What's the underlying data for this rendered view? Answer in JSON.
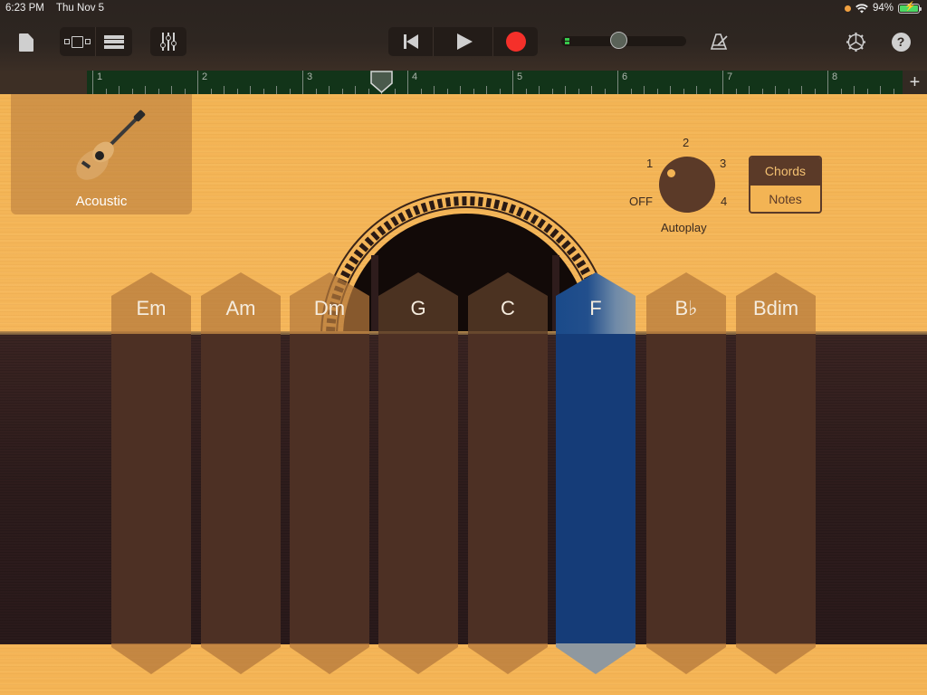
{
  "status_bar": {
    "time": "6:23 PM",
    "date": "Thu Nov 5",
    "battery_percent": "94%",
    "battery_level": 0.94,
    "charging": true
  },
  "toolbar": {
    "left_icons": [
      "document-icon",
      "tracks-view-icon",
      "list-view-icon",
      "mixer-icon"
    ],
    "transport": [
      "go-to-beginning-icon",
      "play-icon",
      "record-icon"
    ],
    "volume_level": 0.4,
    "right_icons": [
      "metronome-icon",
      "settings-icon",
      "help-icon"
    ],
    "help_label": "?"
  },
  "ruler": {
    "bars": [
      "1",
      "2",
      "3",
      "4",
      "5",
      "6",
      "7",
      "8"
    ],
    "playhead_bar_position": 3.75,
    "add_label": "+"
  },
  "instrument": {
    "name": "Acoustic",
    "icon": "acoustic-guitar-icon"
  },
  "autoplay": {
    "label": "Autoplay",
    "positions": [
      "OFF",
      "1",
      "2",
      "3",
      "4"
    ],
    "selected": "1"
  },
  "mode_toggle": {
    "options": [
      "Chords",
      "Notes"
    ],
    "selected": "Chords"
  },
  "chords": [
    {
      "label": "Em",
      "active": false
    },
    {
      "label": "Am",
      "active": false
    },
    {
      "label": "Dm",
      "active": false
    },
    {
      "label": "G",
      "active": false
    },
    {
      "label": "C",
      "active": false
    },
    {
      "label": "F",
      "active": true
    },
    {
      "label": "B♭",
      "active": false
    },
    {
      "label": "Bdim",
      "active": false
    }
  ],
  "colors": {
    "wood": "#f3b454",
    "record": "#f5302a",
    "active_chord": "#153c78",
    "ruler": "#123419"
  }
}
